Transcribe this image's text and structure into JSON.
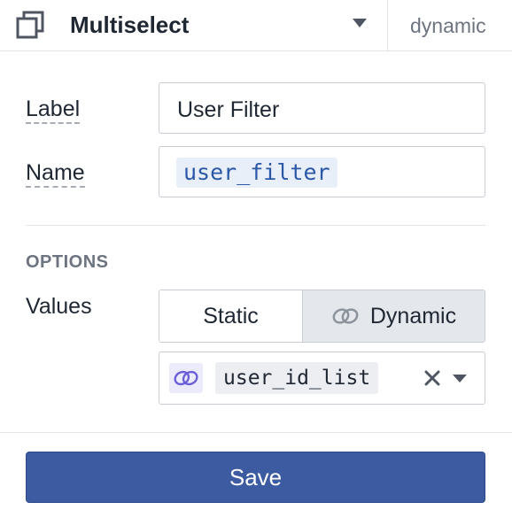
{
  "header": {
    "type_icon": "duplicate-squares-icon",
    "title": "Multiselect",
    "mode_label": "dynamic"
  },
  "form": {
    "label_label": "Label",
    "label_value": "User Filter",
    "name_label": "Name",
    "name_value": "user_filter"
  },
  "options": {
    "section_title": "OPTIONS",
    "values_label": "Values",
    "segments": [
      {
        "label": "Static",
        "selected": false
      },
      {
        "label": "Dynamic",
        "selected": true,
        "icon": "link-icon"
      }
    ],
    "dynamic_source": {
      "icon": "link-icon",
      "value": "user_id_list"
    }
  },
  "footer": {
    "save_label": "Save"
  },
  "colors": {
    "primary": "#3d5ba0",
    "code_text": "#2a58a6",
    "link_icon": "#6a5fd6"
  }
}
